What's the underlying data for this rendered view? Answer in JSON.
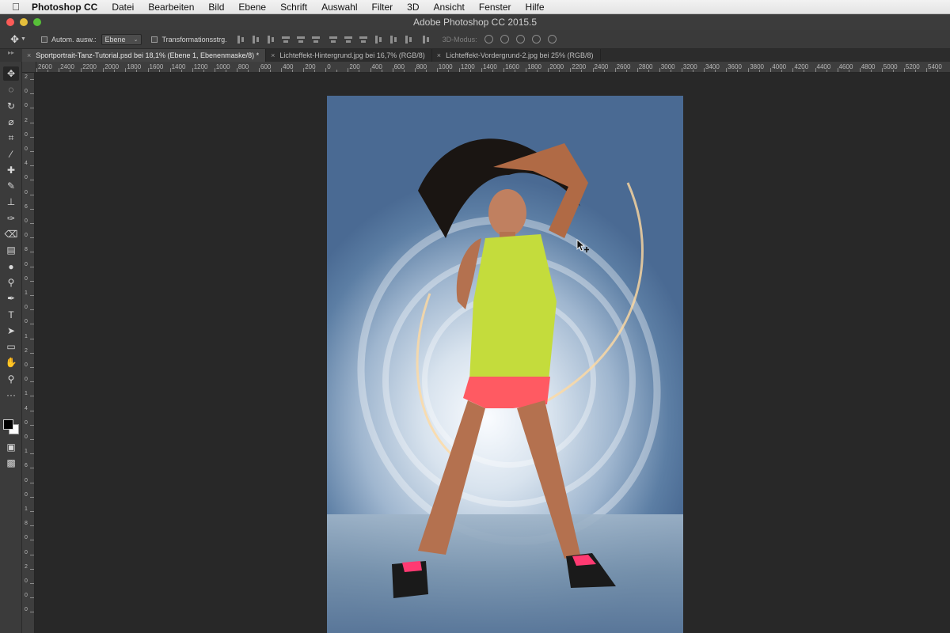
{
  "menubar": {
    "items": [
      "Photoshop CC",
      "Datei",
      "Bearbeiten",
      "Bild",
      "Ebene",
      "Schrift",
      "Auswahl",
      "Filter",
      "3D",
      "Ansicht",
      "Fenster",
      "Hilfe"
    ]
  },
  "window": {
    "title": "Adobe Photoshop CC 2015.5"
  },
  "options": {
    "auto_select_label": "Autom. ausw.:",
    "layer_select_value": "Ebene",
    "transform_label": "Transformationsstrg.",
    "mode3d_label": "3D-Modus:"
  },
  "tabs": [
    {
      "label": "Sportportrait-Tanz-Tutorial.psd bei 18,1% (Ebene 1, Ebenenmaske/8) *",
      "active": true
    },
    {
      "label": "Lichteffekt-Hintergrund.jpg bei 16,7% (RGB/8)",
      "active": false
    },
    {
      "label": "Lichteffekt-Vordergrund-2.jpg bei 25% (RGB/8)",
      "active": false
    }
  ],
  "ruler_h_labels": [
    "2600",
    "2400",
    "2200",
    "2000",
    "1800",
    "1600",
    "1400",
    "1200",
    "1000",
    "800",
    "600",
    "400",
    "200",
    "0",
    "200",
    "400",
    "600",
    "800",
    "1000",
    "1200",
    "1400",
    "1600",
    "1800",
    "2000",
    "2200",
    "2400",
    "2600",
    "2800",
    "3000",
    "3200",
    "3400",
    "3600",
    "3800",
    "4000",
    "4200",
    "4400",
    "4600",
    "4800",
    "5000",
    "5200",
    "5400"
  ],
  "ruler_v_labels": [
    "2",
    "0",
    "0",
    "2",
    "0",
    "0",
    "4",
    "0",
    "0",
    "6",
    "0",
    "0",
    "8",
    "0",
    "0",
    "1",
    "0",
    "0",
    "1",
    "2",
    "0",
    "0",
    "1",
    "4",
    "0",
    "0",
    "1",
    "6",
    "0",
    "0",
    "1",
    "8",
    "0",
    "0",
    "2",
    "0",
    "0",
    "0"
  ],
  "tools": [
    "move-tool-icon",
    "marquee-tool-icon",
    "lasso-tool-icon",
    "quick-select-tool-icon",
    "crop-tool-icon",
    "eyedropper-tool-icon",
    "healing-brush-tool-icon",
    "brush-tool-icon",
    "stamp-tool-icon",
    "history-brush-tool-icon",
    "eraser-tool-icon",
    "gradient-tool-icon",
    "blur-tool-icon",
    "dodge-tool-icon",
    "pen-tool-icon",
    "type-tool-icon",
    "path-select-tool-icon",
    "shape-tool-icon",
    "hand-tool-icon",
    "zoom-tool-icon",
    "more-tools-icon"
  ],
  "colors": {
    "foreground": "#000000",
    "background": "#ffffff"
  }
}
